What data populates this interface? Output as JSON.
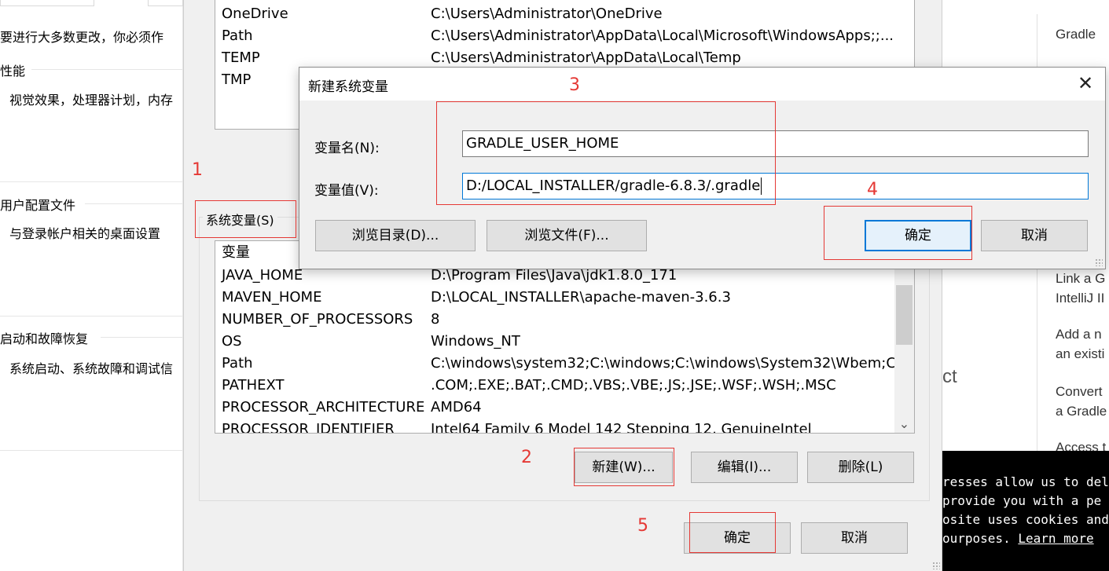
{
  "left_panel": {
    "line1": "要进行大多数更改，你必须作",
    "performance_heading": "性能",
    "performance_desc": "视觉效果，处理器计划，内存",
    "user_profiles_heading": "用户配置文件",
    "user_profiles_desc": "与登录帐户相关的桌面设置",
    "startup_heading": "启动和故障恢复",
    "startup_desc": "系统启动、系统故障和调试信"
  },
  "env_dialog": {
    "user_vars": [
      {
        "name": "OneDrive",
        "value": "C:\\Users\\Administrator\\OneDrive"
      },
      {
        "name": "Path",
        "value": "C:\\Users\\Administrator\\AppData\\Local\\Microsoft\\WindowsApps;;..."
      },
      {
        "name": "TEMP",
        "value": "C:\\Users\\Administrator\\AppData\\Local\\Temp"
      },
      {
        "name": "TMP",
        "value": ""
      }
    ],
    "system_group_label": "系统变量(S)",
    "column_header": "变量",
    "system_vars": [
      {
        "name": "JAVA_HOME",
        "value": "D:\\Program Files\\Java\\jdk1.8.0_171"
      },
      {
        "name": "MAVEN_HOME",
        "value": "D:\\LOCAL_INSTALLER\\apache-maven-3.6.3"
      },
      {
        "name": "NUMBER_OF_PROCESSORS",
        "value": "8"
      },
      {
        "name": "OS",
        "value": "Windows_NT"
      },
      {
        "name": "Path",
        "value": "C:\\windows\\system32;C:\\windows;C:\\windows\\System32\\Wbem;C:..."
      },
      {
        "name": "PATHEXT",
        "value": ".COM;.EXE;.BAT;.CMD;.VBS;.VBE;.JS;.JSE;.WSF;.WSH;.MSC"
      },
      {
        "name": "PROCESSOR_ARCHITECTURE",
        "value": "AMD64"
      },
      {
        "name": "PROCESSOR_IDENTIFIER",
        "value": "Intel64 Family 6 Model 142 Stepping 12, GenuineIntel"
      }
    ],
    "new_button": "新建(W)...",
    "edit_button": "编辑(I)...",
    "delete_button": "删除(L)",
    "ok_button": "确定",
    "cancel_button": "取消",
    "scroll_down_glyph": "⌄"
  },
  "new_var_dialog": {
    "title": "新建系统变量",
    "close_glyph": "✕",
    "name_label": "变量名(N):",
    "value_label": "变量值(V):",
    "name_value": "GRADLE_USER_HOME",
    "value_value": "D:/LOCAL_INSTALLER/gradle-6.8.3/.gradle",
    "browse_dir_button": "浏览目录(D)...",
    "browse_file_button": "浏览文件(F)...",
    "ok_button": "确定",
    "cancel_button": "取消"
  },
  "annotations": {
    "n1": "1",
    "n2": "2",
    "n3": "3",
    "n4": "4",
    "n5": "5"
  },
  "right_page": {
    "gradle": "Gradle",
    "link_a_1": "Link a G",
    "link_a_2": "IntelliJ II",
    "add_a_1": "Add a n",
    "add_a_2": "an existi",
    "convert_1": "Convert",
    "convert_2": "a Gradle",
    "access": "Access t",
    "partial_ct": "ct",
    "cookie_1": "resses allow us to del",
    "cookie_2": " provide you with a pe",
    "cookie_3": "osite uses cookies and",
    "cookie_4_text": "ourposes. ",
    "cookie_4_link": "Learn more"
  },
  "colors": {
    "annotation_red": "#e53935",
    "focus_blue": "#0078d7",
    "dialog_bg": "#f0f0f0"
  }
}
